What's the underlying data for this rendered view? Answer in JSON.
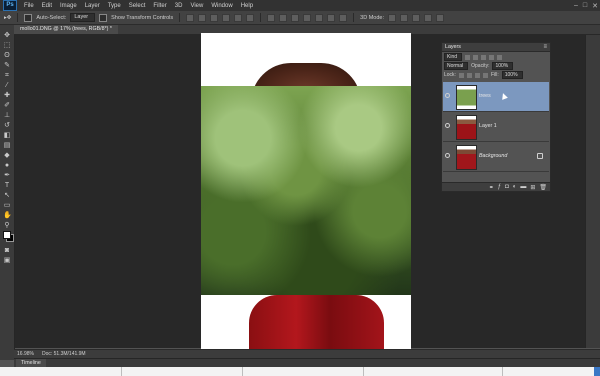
{
  "app": {
    "logo": "Ps"
  },
  "menu": [
    "File",
    "Edit",
    "Image",
    "Layer",
    "Type",
    "Select",
    "Filter",
    "3D",
    "View",
    "Window",
    "Help"
  ],
  "window_controls": {
    "minimize": "–",
    "maximize": "□",
    "close": "✕"
  },
  "options_bar": {
    "auto_select_label": "Auto-Select:",
    "auto_select_value": "Layer",
    "show_transform_label": "Show Transform Controls",
    "mode_3d_label": "3D Mode:"
  },
  "document": {
    "tab_title": "mollo01.DNG @ 17% (trees, RGB/8*) *"
  },
  "status": {
    "zoom": "16.98%",
    "doc_size": "Doc: 51.3M/141.9M"
  },
  "timeline": {
    "tab_label": "Timeline"
  },
  "layers_panel": {
    "title": "Layers",
    "menu_icon": "≡",
    "kind_filter": "Kind",
    "blend_mode": "Normal",
    "opacity_label": "Opacity:",
    "opacity_value": "100%",
    "lock_label": "Lock:",
    "fill_label": "Fill:",
    "fill_value": "100%",
    "layers": [
      {
        "name": "trees",
        "selected": true
      },
      {
        "name": "Layer 1",
        "selected": false
      },
      {
        "name": "Background",
        "selected": false,
        "locked": true
      }
    ],
    "footer_icons": [
      "link-icon",
      "fx-icon",
      "mask-icon",
      "adjustment-icon",
      "group-icon",
      "new-layer-icon",
      "trash-icon"
    ]
  },
  "colors": {
    "accent": "#7c98bf",
    "workspace": "#282828",
    "panel": "#535353"
  }
}
